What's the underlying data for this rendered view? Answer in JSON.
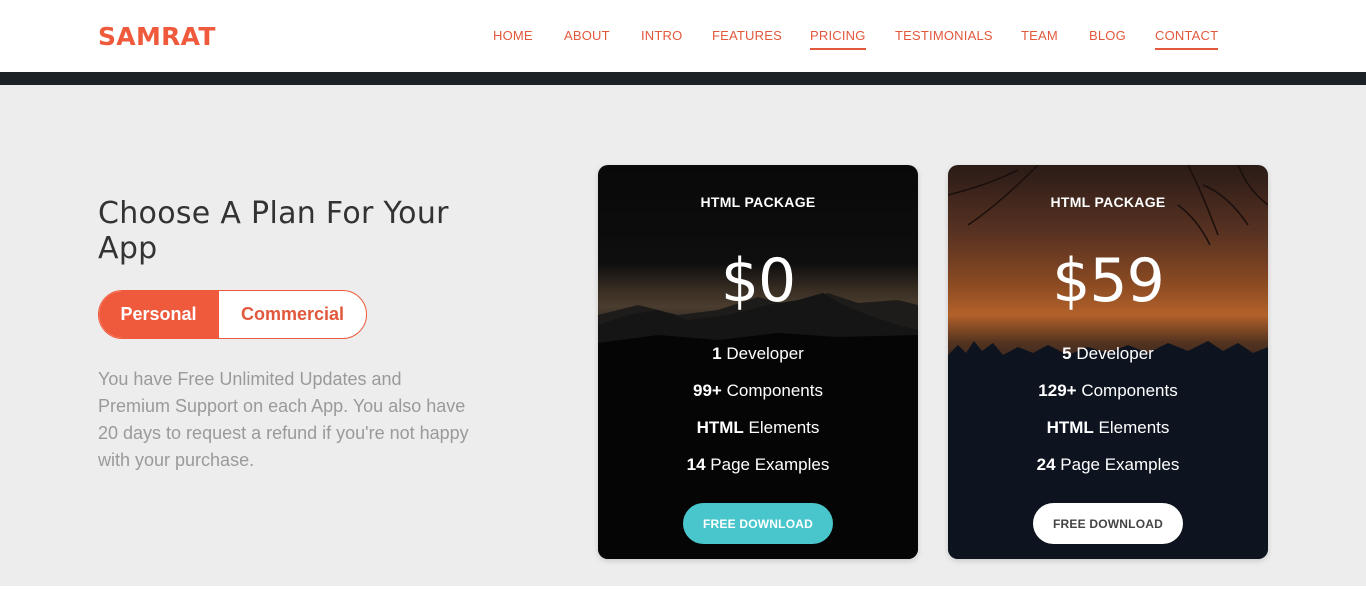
{
  "brand": {
    "name": "SAMRAT"
  },
  "nav": {
    "items": [
      {
        "label": "HOME"
      },
      {
        "label": "ABOUT"
      },
      {
        "label": "INTRO"
      },
      {
        "label": "FEATURES"
      },
      {
        "label": "PRICING",
        "active": true
      },
      {
        "label": "TESTIMONIALS"
      },
      {
        "label": "TEAM"
      },
      {
        "label": "BLOG"
      },
      {
        "label": "CONTACT",
        "active": true
      }
    ]
  },
  "pricing": {
    "heading": "Choose A Plan For Your App",
    "toggle": {
      "personal": "Personal",
      "commercial": "Commercial",
      "selected": "Personal"
    },
    "description": "You have Free Unlimited Updates and Premium Support on each App. You also have 20 days to request a refund if you're not happy with your purchase.",
    "cards": [
      {
        "package": "HTML PACKAGE",
        "price": "$0",
        "features": [
          {
            "bold": "1",
            "text": "Developer"
          },
          {
            "bold": "99+",
            "text": "Components"
          },
          {
            "bold": "HTML",
            "text": "Elements"
          },
          {
            "bold": "14",
            "text": "Page Examples"
          }
        ],
        "button": "FREE DOWNLOAD"
      },
      {
        "package": "HTML PACKAGE",
        "price": "$59",
        "features": [
          {
            "bold": "5",
            "text": "Developer"
          },
          {
            "bold": "129+",
            "text": "Components"
          },
          {
            "bold": "HTML",
            "text": "Elements"
          },
          {
            "bold": "24",
            "text": "Page Examples"
          }
        ],
        "button": "FREE DOWNLOAD"
      }
    ]
  },
  "colors": {
    "accent": "#f05a3c",
    "teal_button": "#49c6cc",
    "dark_bar": "#1c2226",
    "page_bg": "#ededed"
  }
}
